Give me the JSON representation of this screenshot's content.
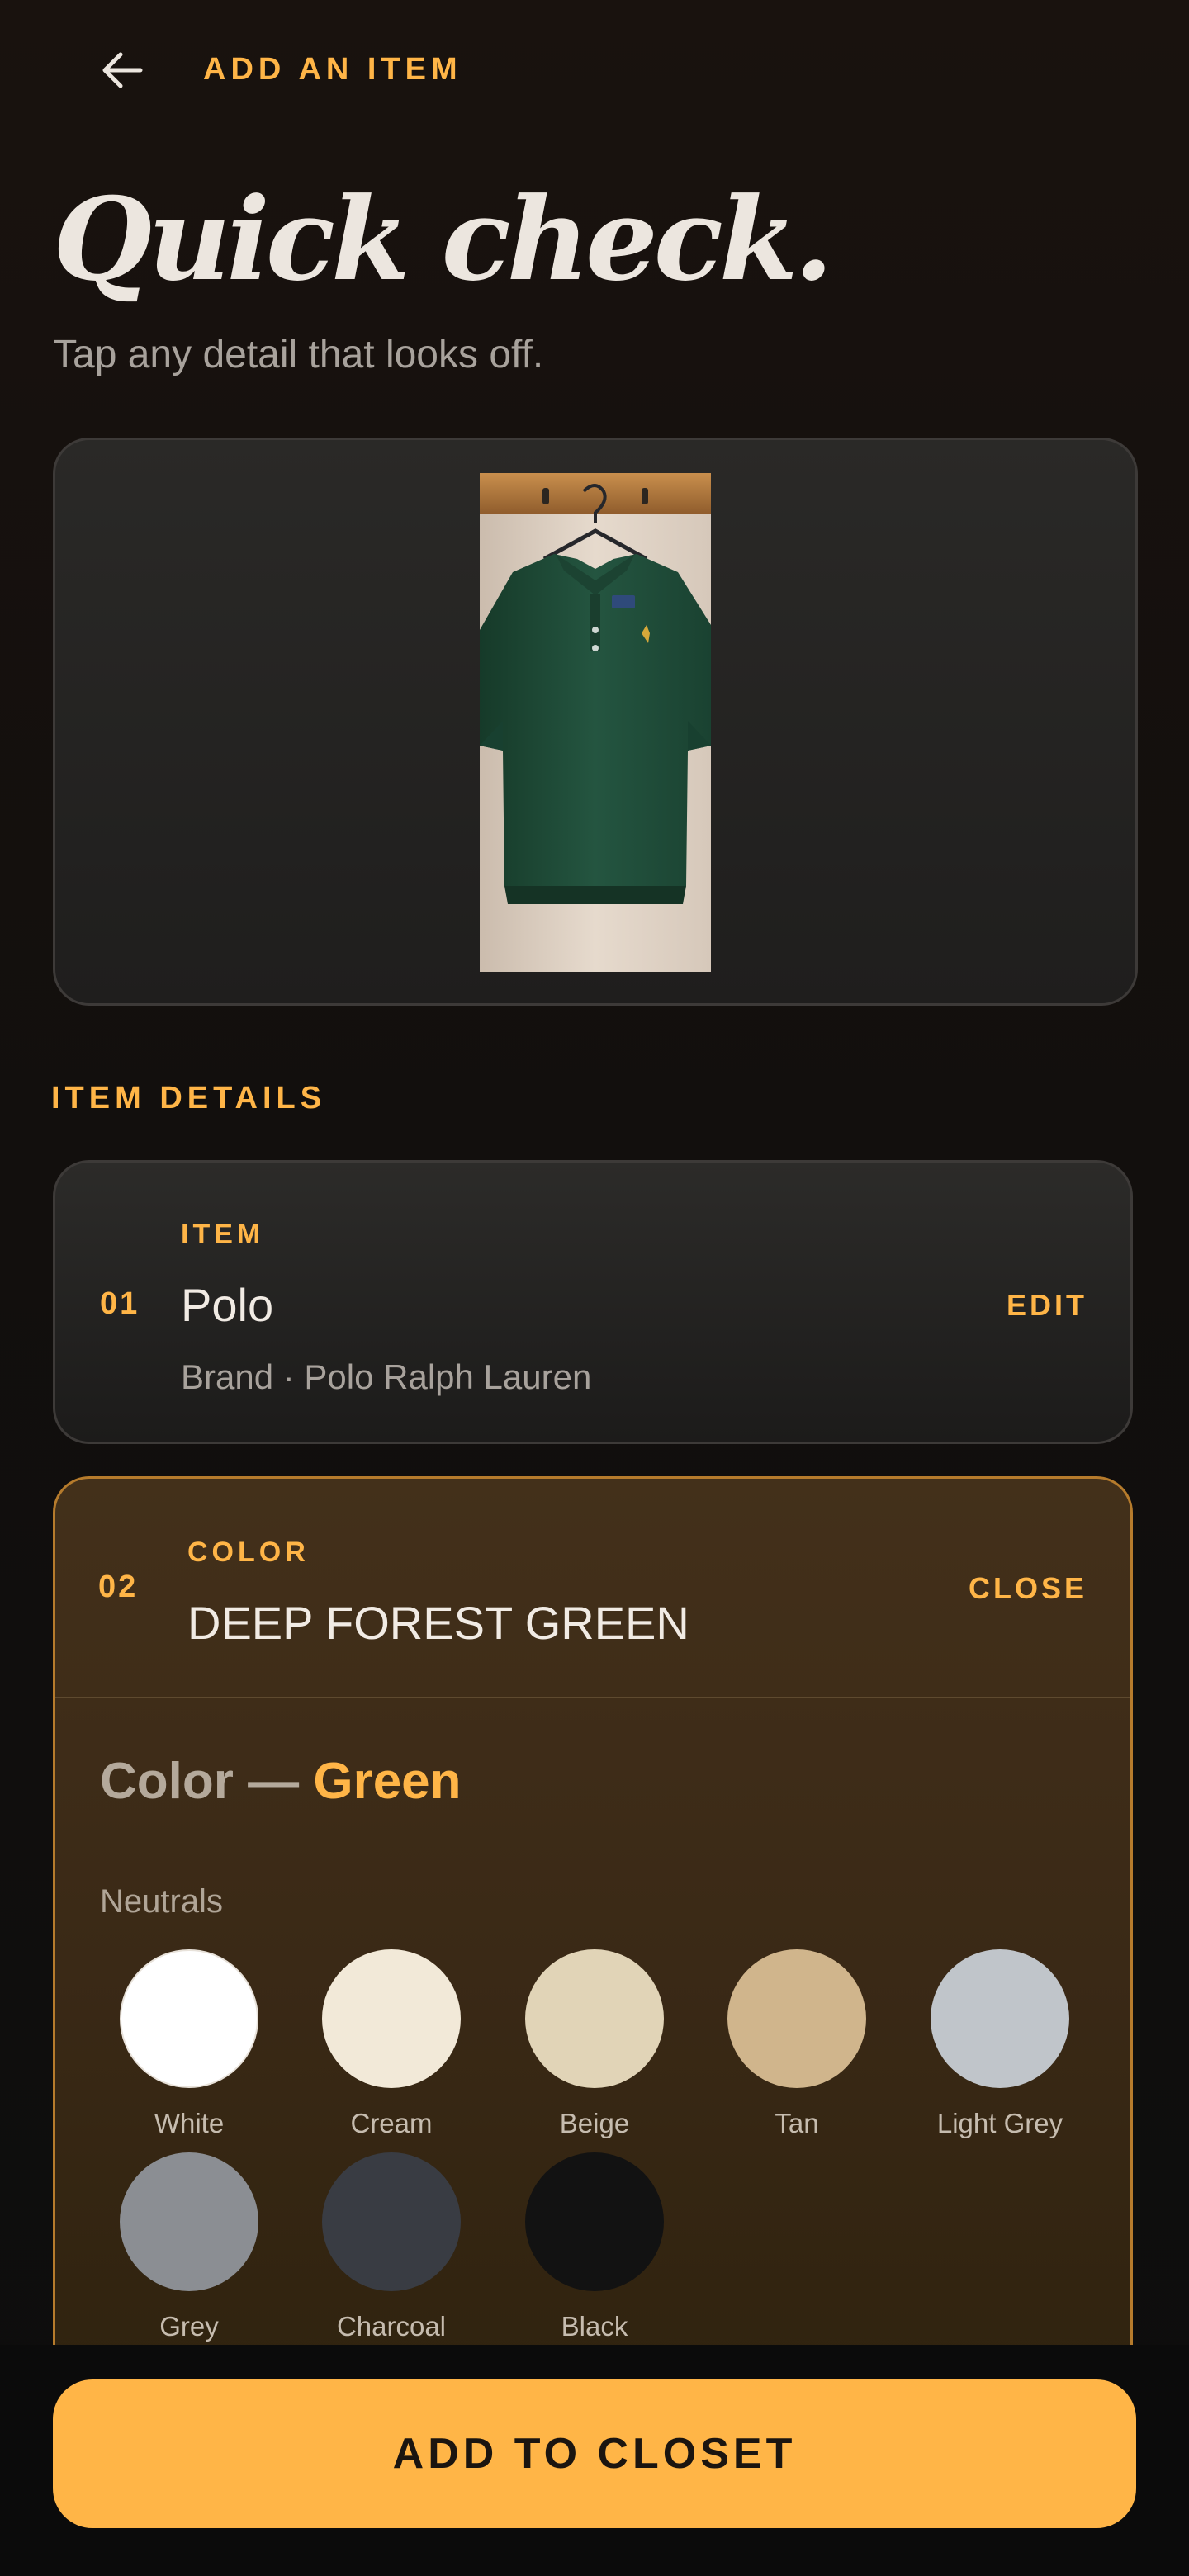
{
  "header": {
    "back_icon": "arrow-left-icon",
    "title": "ADD AN ITEM"
  },
  "hero": {
    "headline": "Quick check.",
    "subhead": "Tap any detail that looks off."
  },
  "photo": {
    "description_icon": "garment-photo",
    "colors": {
      "shirt": "#1f4a35",
      "wall": "#e3d6c9",
      "rack": "#b07a3e"
    }
  },
  "details": {
    "section_label": "ITEM DETAILS",
    "item": {
      "number": "01",
      "label": "ITEM",
      "value": "Polo",
      "sub": "Brand · Polo Ralph Lauren",
      "action": "EDIT"
    },
    "color": {
      "number": "02",
      "label": "COLOR",
      "value": "DEEP FOREST GREEN",
      "action": "CLOSE",
      "picker_title_prefix": "Color —",
      "picker_title_accent": "Green",
      "group_label": "Neutrals",
      "swatches": [
        {
          "name": "White",
          "hex": "#ffffff"
        },
        {
          "name": "Cream",
          "hex": "#f2e9d8"
        },
        {
          "name": "Beige",
          "hex": "#e1d4b7"
        },
        {
          "name": "Tan",
          "hex": "#d0b58c"
        },
        {
          "name": "Light Grey",
          "hex": "#c0c5ca"
        },
        {
          "name": "Grey",
          "hex": "#8b8e93"
        },
        {
          "name": "Charcoal",
          "hex": "#393c43"
        },
        {
          "name": "Black",
          "hex": "#121212"
        }
      ]
    }
  },
  "footer": {
    "cta_label": "ADD TO CLOSET"
  },
  "theme": {
    "accent": "#ffb547",
    "background": "#140f0c",
    "card": "#2a2927",
    "expanded_card": "#3e2c18"
  }
}
